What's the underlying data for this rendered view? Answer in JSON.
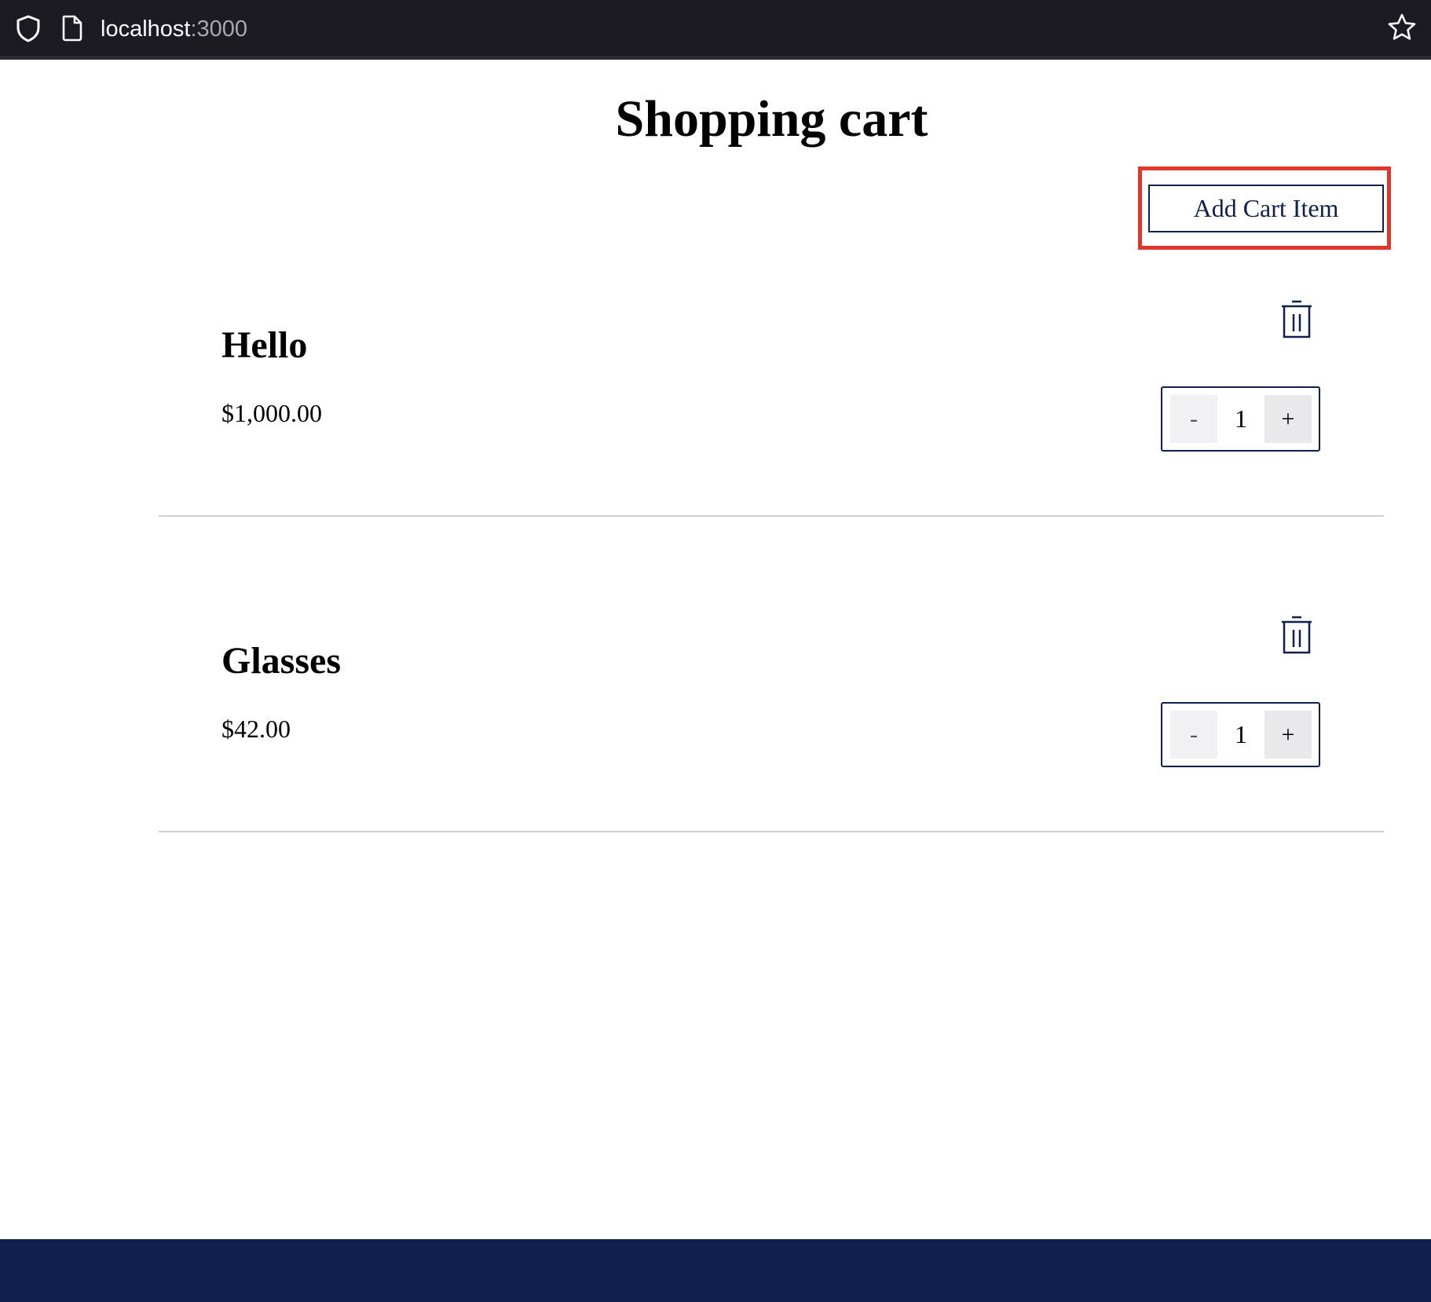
{
  "browser": {
    "url_host": "localhost",
    "url_port": ":3000"
  },
  "page": {
    "title": "Shopping cart",
    "add_button_label": "Add Cart Item"
  },
  "cart": {
    "items": [
      {
        "name": "Hello",
        "price": "$1,000.00",
        "quantity": "1",
        "minus_label": "-",
        "plus_label": "+"
      },
      {
        "name": "Glasses",
        "price": "$42.00",
        "quantity": "1",
        "minus_label": "-",
        "plus_label": "+"
      }
    ]
  },
  "colors": {
    "brand_navy": "#0f1f4e",
    "highlight_red": "#e0362c",
    "browser_bar": "#1c1b22"
  },
  "icons": {
    "browser_security": "shield-icon",
    "browser_page": "page-icon",
    "browser_bookmark": "star-icon",
    "delete_item": "trash-icon"
  }
}
